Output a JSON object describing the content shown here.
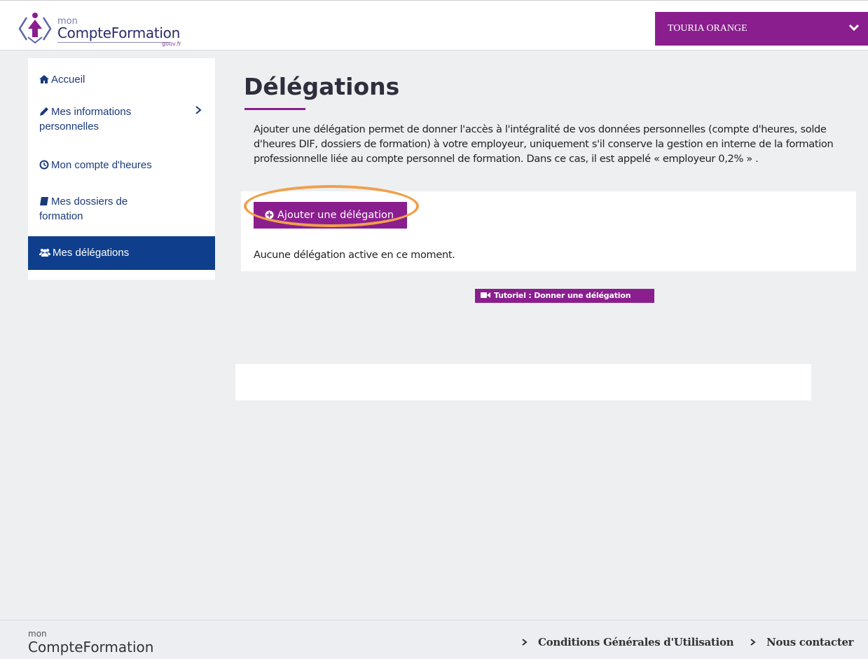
{
  "header": {
    "logo_mon": "mon",
    "logo_main": "CompteFormation",
    "logo_gouv": "gouv.fr",
    "user_name": "TOURIA ORANGE"
  },
  "sidebar": {
    "items": [
      {
        "label": "Accueil",
        "icon": "home-icon"
      },
      {
        "label": "Mes informations personnelles",
        "icon": "pencil-icon"
      },
      {
        "label": "Mon compte d'heures",
        "icon": "clock-icon"
      },
      {
        "label": "Mes dossiers de formation",
        "icon": "book-icon"
      },
      {
        "label": "Mes délégations",
        "icon": "users-icon"
      }
    ]
  },
  "main": {
    "title": "Délégations",
    "intro": "Ajouter une délégation permet de donner l'accès à l'intégralité de vos données personnelles (compte d'heures, solde d'heures DIF, dossiers de formation) à votre employeur, uniquement s'il conserve la gestion en interne de la formation professionnelle liée au compte personnel de formation. Dans ce cas, il est appelé « employeur 0,2% » .",
    "add_button": "Ajouter une délégation",
    "empty_message": "Aucune délégation active en ce moment.",
    "tutorial": "Tutoriel : Donner une délégation"
  },
  "footer": {
    "logo_mon": "mon",
    "logo_main": "CompteFormation",
    "links": [
      "Conditions Générales d'Utilisation",
      "Nous contacter"
    ]
  },
  "colors": {
    "brand_purple": "#8b1e8e",
    "nav_blue": "#1b3a7a",
    "active_blue": "#0f3f8c",
    "highlight_orange": "#f0a04b"
  }
}
